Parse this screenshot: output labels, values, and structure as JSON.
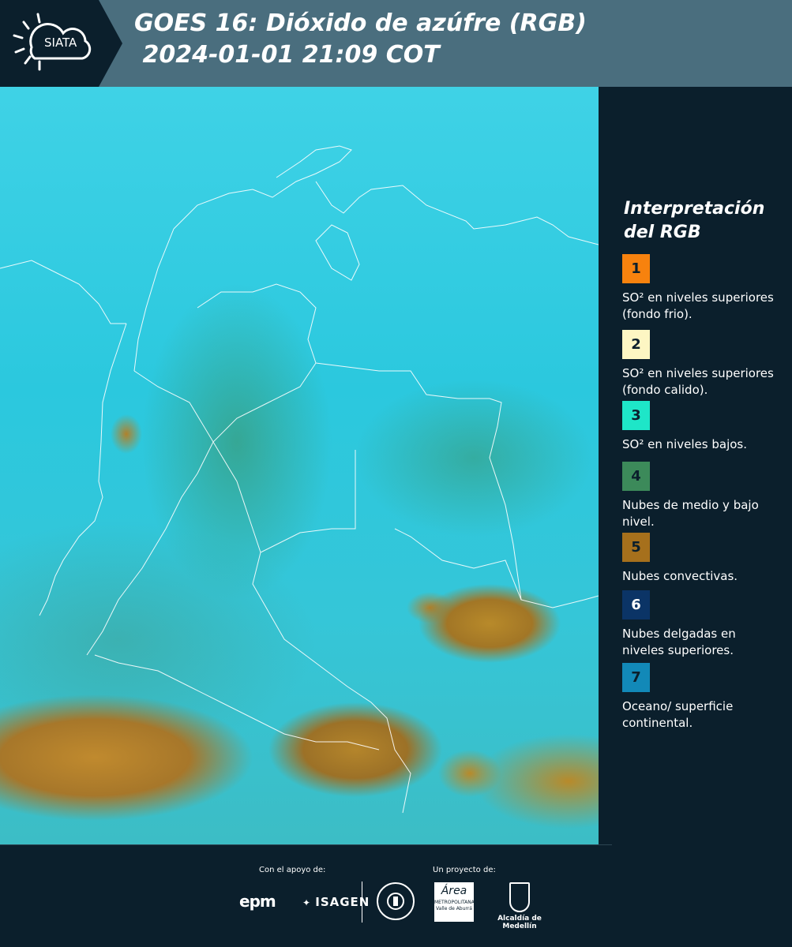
{
  "header": {
    "logo_text": "SIATA",
    "title_line1": "GOES 16: Dióxido de azúfre (RGB)",
    "title_line2": " 2024-01-01 21:09 COT"
  },
  "legend": {
    "title": "Interpretación del RGB",
    "items": [
      {
        "number": "1",
        "color": "#f7820e",
        "text": "SO² en niveles superiores (fondo frio)."
      },
      {
        "number": "2",
        "color": "#fdf6c3",
        "text": "SO² en niveles superiores (fondo calido)."
      },
      {
        "number": "3",
        "color": "#1ee6c8",
        "text": "SO² en niveles bajos."
      },
      {
        "number": "4",
        "color": "#3c8a5a",
        "text": "Nubes de medio y bajo nivel."
      },
      {
        "number": "5",
        "color": "#a6701c",
        "text": "Nubes convectivas."
      },
      {
        "number": "6",
        "color": "#0b3466",
        "text": "Nubes delgadas en niveles superiores."
      },
      {
        "number": "7",
        "color": "#1289b8",
        "text": "Oceano/ superficie continental."
      }
    ]
  },
  "footer": {
    "support_label": "Con el apoyo de:",
    "project_label": "Un proyecto de:",
    "epm": "epm",
    "isagen": "ISAGEN",
    "area_name": "Área",
    "area_sub": "METROPOLITANA Valle de Aburrá",
    "medellin": "Alcaldía de Medellín"
  }
}
